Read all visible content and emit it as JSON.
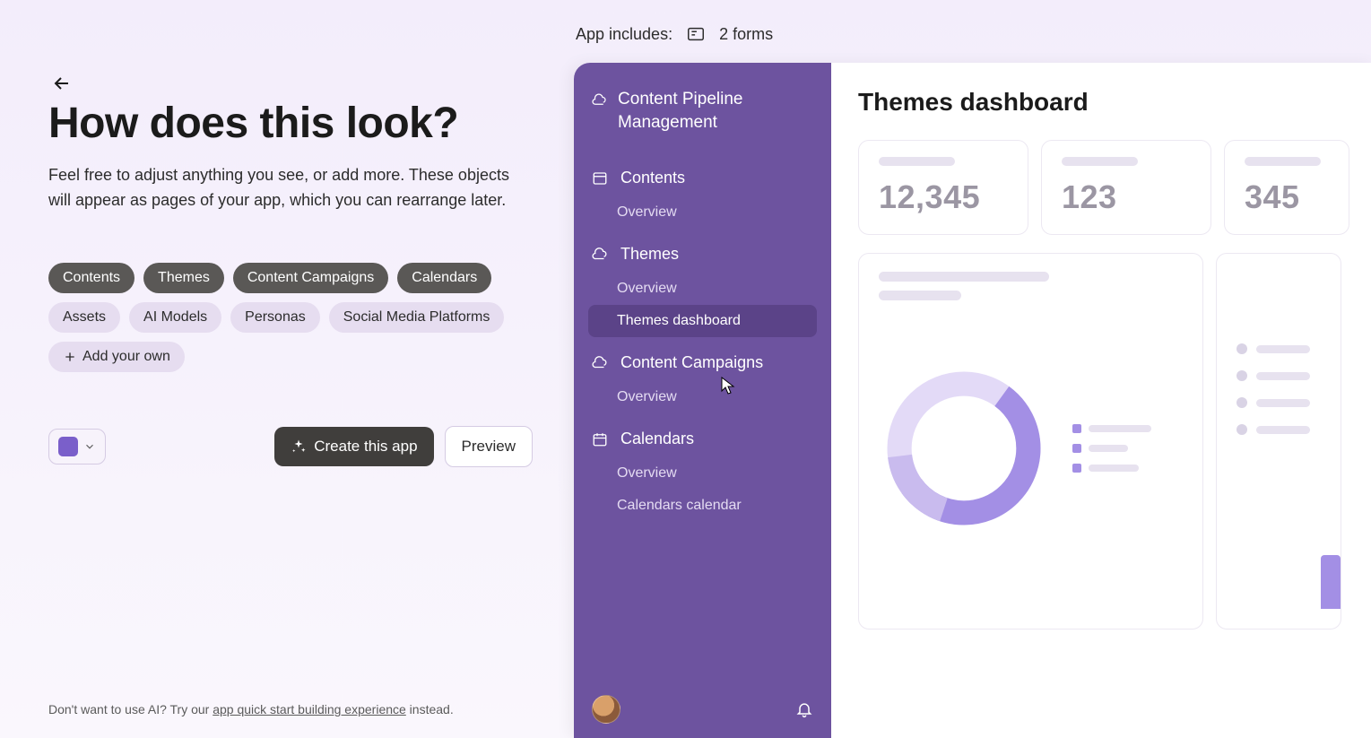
{
  "left": {
    "heading": "How does this look?",
    "subheading": "Feel free to adjust anything you see, or add more. These objects will appear as pages of your app, which you can rearrange later.",
    "chips_filled": [
      "Contents",
      "Themes",
      "Content Campaigns",
      "Calendars"
    ],
    "chips_ghost": [
      "Assets",
      "AI Models",
      "Personas",
      "Social Media Platforms"
    ],
    "add_label": "Add your own",
    "create_label": "Create this app",
    "preview_label": "Preview",
    "color_accent": "#7a5fca",
    "footer_prefix": "Don't want to use AI? Try our ",
    "footer_link": "app quick start building experience",
    "footer_suffix": " instead."
  },
  "includes": {
    "label": "App includes:",
    "forms_count": "2 forms"
  },
  "preview": {
    "app_title": "Content Pipeline Management",
    "sections": [
      {
        "title": "Contents",
        "icon": "table",
        "items": [
          {
            "label": "Overview",
            "active": false
          }
        ]
      },
      {
        "title": "Themes",
        "icon": "cloud",
        "items": [
          {
            "label": "Overview",
            "active": false
          },
          {
            "label": "Themes dashboard",
            "active": true
          }
        ]
      },
      {
        "title": "Content Campaigns",
        "icon": "cloud",
        "items": [
          {
            "label": "Overview",
            "active": false
          }
        ]
      },
      {
        "title": "Calendars",
        "icon": "calendar",
        "items": [
          {
            "label": "Overview",
            "active": false
          },
          {
            "label": "Calendars calendar",
            "active": false
          }
        ]
      }
    ],
    "main": {
      "title": "Themes dashboard",
      "stats": [
        "12,345",
        "123",
        "345"
      ]
    }
  }
}
